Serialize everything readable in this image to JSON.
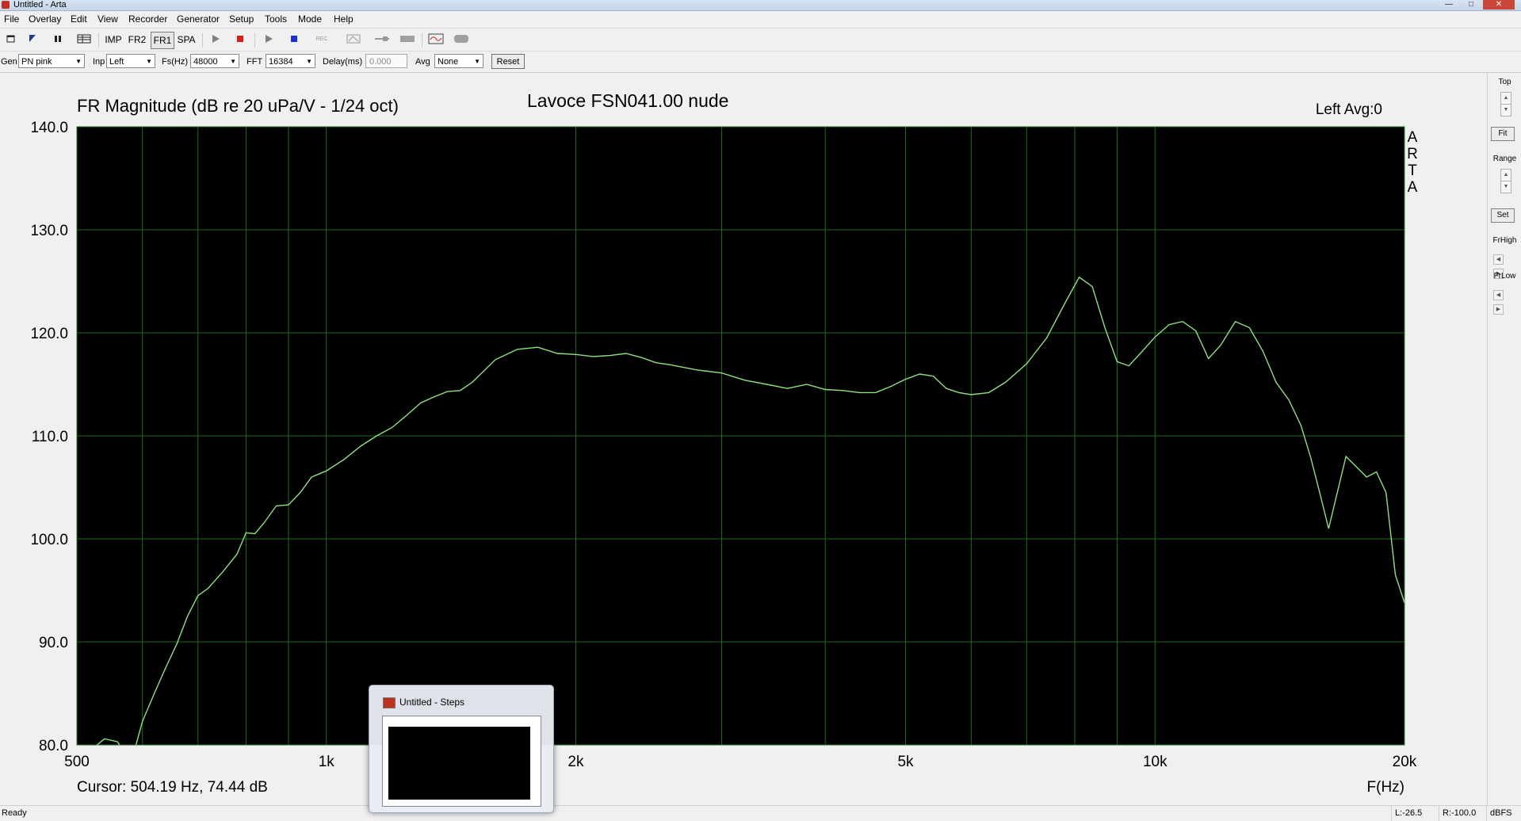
{
  "window": {
    "title": "Untitled - Arta"
  },
  "menu": [
    "File",
    "Overlay",
    "Edit",
    "View",
    "Recorder",
    "Generator",
    "Setup",
    "Tools",
    "Mode",
    "Help"
  ],
  "toolbar": {
    "icons": [
      "new-icon",
      "open-icon",
      "pause-icon",
      "table-icon"
    ],
    "modes": [
      "IMP",
      "FR2",
      "FR1",
      "SPA"
    ],
    "active_mode": "FR1",
    "transport_icons": [
      "play-icon",
      "stop-icon",
      "play-icon",
      "stop-icon",
      "record-icon",
      "sweep-icon",
      "signal-icon",
      "meter-icon",
      "scope-icon",
      "oval-icon"
    ],
    "record_text": "REC"
  },
  "controls": {
    "gen_label": "Gen",
    "gen_value": "PN pink",
    "inp_label": "Inp",
    "inp_value": "Left",
    "fs_label": "Fs(Hz)",
    "fs_value": "48000",
    "fft_label": "FFT",
    "fft_value": "16384",
    "delay_label": "Delay(ms)",
    "delay_value": "0.000",
    "avg_label": "Avg",
    "avg_value": "None",
    "reset_label": "Reset"
  },
  "chart_data": {
    "type": "line",
    "title": "Lavoce FSN041.00  nude",
    "ylabel": "FR Magnitude (dB re 20 uPa/V - 1/24 oct)",
    "xlabel": "F(Hz)",
    "channel_info": "Left  Avg:0",
    "side_text": [
      "A",
      "R",
      "T",
      "A"
    ],
    "x_scale": "log",
    "xlim": [
      500,
      20000
    ],
    "ylim": [
      80,
      140
    ],
    "x_ticks": [
      500,
      1000,
      2000,
      5000,
      10000,
      20000
    ],
    "x_tick_labels": [
      "500",
      "1k",
      "2k",
      "5k",
      "10k",
      "20k"
    ],
    "y_ticks": [
      80,
      90,
      100,
      110,
      120,
      130,
      140
    ],
    "y_tick_labels": [
      "80.0",
      "90.0",
      "100.0",
      "110.0",
      "120.0",
      "130.0",
      "140.0"
    ],
    "grid": true,
    "background": "#000000",
    "grid_color": "#1f6b1f",
    "line_color": "#8fe07f",
    "cursor_text": "Cursor: 504.19 Hz, 74.44 dB",
    "series": [
      {
        "x": [
          500,
          520,
          540,
          560,
          580,
          600,
          620,
          640,
          660,
          680,
          700,
          720,
          750,
          780,
          800,
          820,
          840,
          870,
          900,
          930,
          960,
          1000,
          1050,
          1100,
          1150,
          1200,
          1250,
          1300,
          1350,
          1400,
          1450,
          1500,
          1600,
          1700,
          1800,
          1900,
          2000,
          2100,
          2200,
          2300,
          2400,
          2500,
          2600,
          2800,
          3000,
          3200,
          3400,
          3600,
          3800,
          4000,
          4200,
          4400,
          4600,
          4800,
          5000,
          5200,
          5400,
          5600,
          5800,
          6000,
          6300,
          6600,
          7000,
          7400,
          7800,
          8100,
          8400,
          8700,
          9000,
          9300,
          9600,
          10000,
          10400,
          10800,
          11200,
          11600,
          12000,
          12500,
          13000,
          13500,
          14000,
          14500,
          15000,
          15400,
          15800,
          16200,
          17000,
          18000,
          18500,
          19000,
          19500,
          20000
        ],
        "y": [
          74.4,
          79.5,
          80.6,
          80.3,
          75.5,
          82.3,
          85.0,
          87.5,
          89.8,
          92.5,
          94.5,
          95.2,
          96.8,
          98.5,
          100.6,
          100.5,
          101.5,
          103.2,
          103.3,
          104.5,
          106.0,
          106.6,
          107.7,
          109.0,
          110.0,
          110.8,
          112.0,
          113.2,
          113.8,
          114.3,
          114.4,
          115.2,
          117.4,
          118.4,
          118.6,
          118.0,
          117.9,
          117.7,
          117.8,
          118.0,
          117.6,
          117.1,
          116.9,
          116.4,
          116.1,
          115.4,
          115.0,
          114.6,
          115.0,
          114.5,
          114.4,
          114.2,
          114.2,
          114.8,
          115.5,
          116.0,
          115.8,
          114.6,
          114.2,
          114.0,
          114.2,
          115.2,
          117.0,
          119.5,
          123.0,
          125.4,
          124.5,
          120.5,
          117.2,
          116.8,
          118.0,
          119.6,
          120.8,
          121.1,
          120.2,
          117.5,
          118.8,
          121.1,
          120.5,
          118.2,
          115.2,
          113.5,
          111.0,
          108.0,
          104.5,
          101.0,
          108.0,
          106.0,
          106.5,
          104.5,
          96.5,
          93.8
        ]
      }
    ]
  },
  "right_panel": {
    "top_label": "Top",
    "fit_label": "Fit",
    "range_label": "Range",
    "set_label": "Set",
    "frhigh_label": "FrHigh",
    "frlow_label": "FrLow"
  },
  "status": {
    "left": "Ready",
    "l_level": "L:-26.5",
    "r_level": "R:-100.0",
    "unit": "dBFS"
  },
  "taskbar_preview": {
    "title": "Untitled - Steps"
  }
}
